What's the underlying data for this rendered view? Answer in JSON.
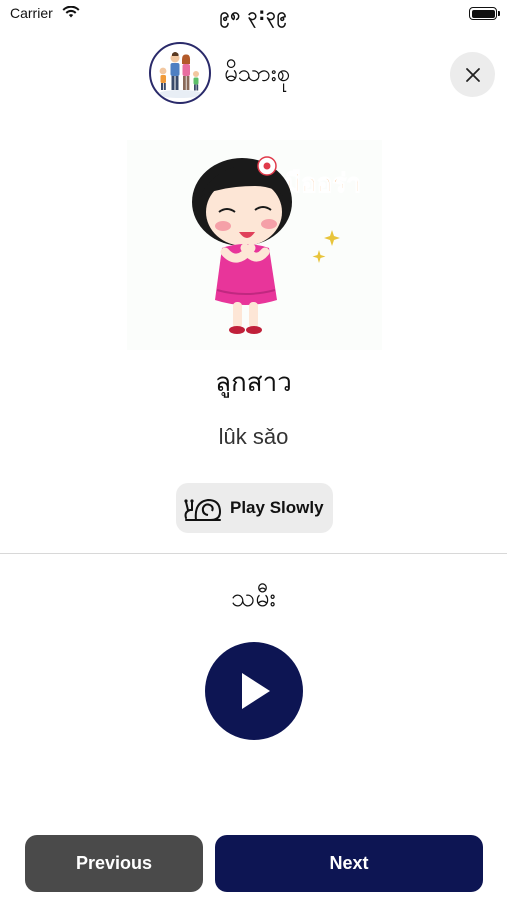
{
  "status_bar": {
    "carrier": "Carrier",
    "time": "၉၈ ၃:၃၉",
    "wifi_icon": "wifi-icon",
    "battery_icon": "battery-icon"
  },
  "header": {
    "category_title": "မိသားစု",
    "avatar_icon": "family-avatar-icon",
    "close_icon": "close-icon"
  },
  "card": {
    "sticker_text": "มืออร่า",
    "word": "ลูกสาว",
    "romanization": "lûk sǎo",
    "play_slowly_label": "Play Slowly",
    "snail_icon": "snail-icon",
    "translation": "သမီး",
    "play_icon": "play-icon"
  },
  "navigation": {
    "previous_label": "Previous",
    "next_label": "Next"
  },
  "colors": {
    "primary_navy": "#0d1553",
    "secondary_gray": "#4a4a4a",
    "light_gray": "#ececec",
    "sticker_pink": "#e8359a",
    "sticker_text_orange": "#f08c2e"
  }
}
